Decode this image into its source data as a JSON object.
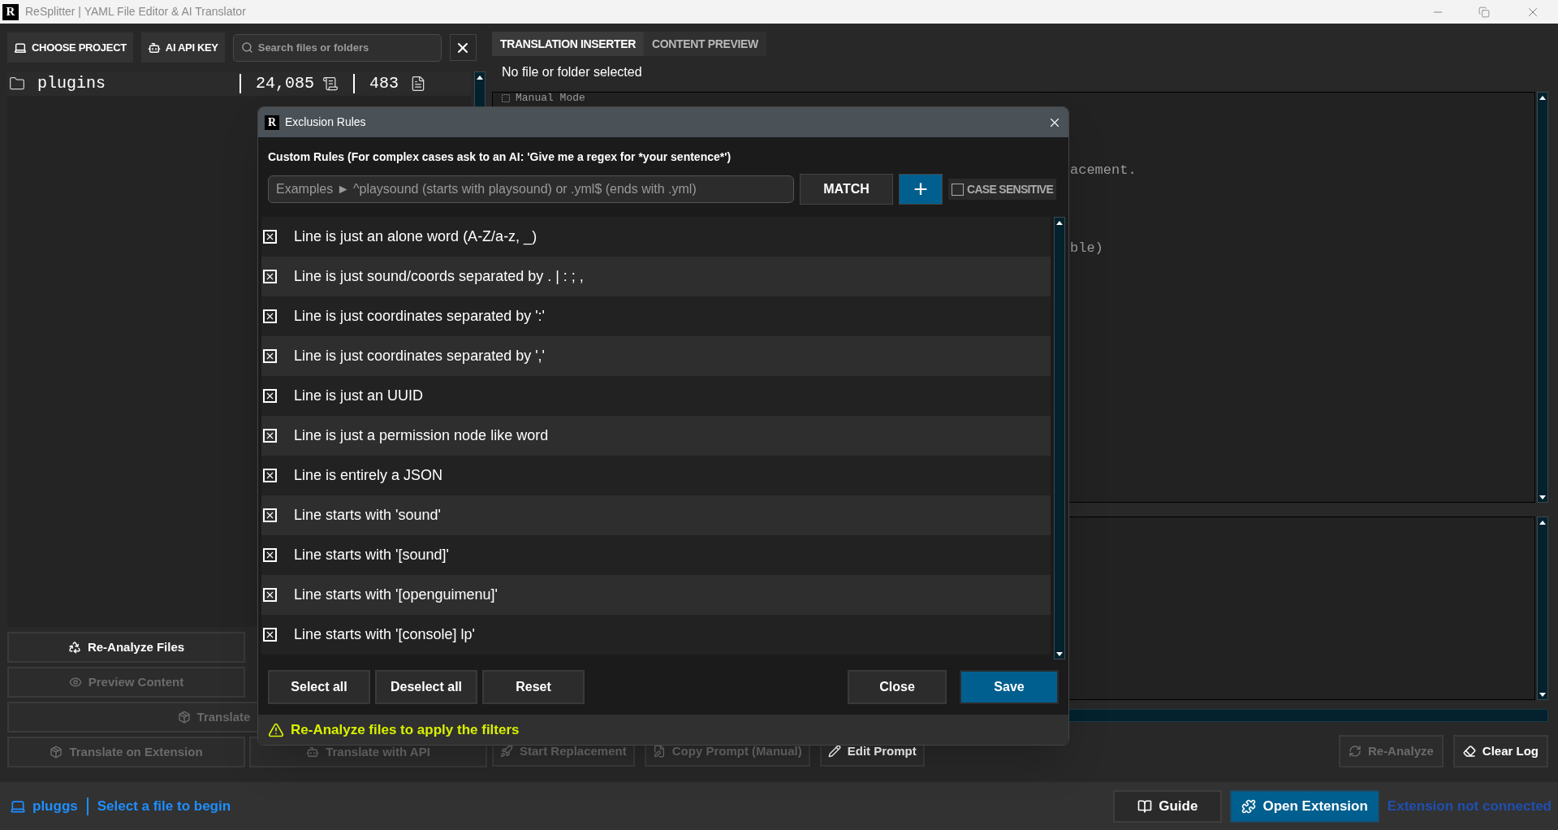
{
  "window": {
    "app_icon": "R",
    "title": "ReSplitter | YAML File Editor & AI Translator"
  },
  "toolbar": {
    "buttons": [
      {
        "label": "CHOOSE PROJECT",
        "kind": "project"
      },
      {
        "label": "AI API KEY",
        "kind": "api"
      }
    ],
    "search": {
      "placeholder": "Search files or folders"
    }
  },
  "tabs": [
    {
      "label": "TRANSLATION INSERTER",
      "selected": true
    },
    {
      "label": "CONTENT PREVIEW",
      "selected": false
    }
  ],
  "file_tree": {
    "folder": "plugins",
    "lines_count": "24,085",
    "files_count": "483"
  },
  "selection_status": "No file or folder selected",
  "editor": {
    "mode": "Manual Mode",
    "fragments": [
      "acement.",
      "ble)"
    ]
  },
  "left_actions": [
    {
      "label": "Re-Analyze Files",
      "kind": "recycle",
      "disabled": false
    },
    {
      "label": "Preview Content",
      "kind": "eye",
      "disabled": true
    },
    {
      "label": "Translate",
      "kind": "package",
      "disabled": true
    },
    {
      "label": "Translate on Extension",
      "kind": "package",
      "disabled": true
    },
    {
      "label": "Translate with API",
      "kind": "bot",
      "disabled": true
    }
  ],
  "progress": {
    "level": 0
  },
  "right_actions": [
    {
      "label": "Start Replacement",
      "kind": "rocket",
      "disabled": true
    },
    {
      "label": "Copy Prompt (Manual)",
      "kind": "filepen",
      "disabled": true
    },
    {
      "label": "Edit Prompt",
      "kind": "pencil",
      "disabled": false
    }
  ],
  "log_actions": [
    {
      "label": "Re-Analyze",
      "kind": "refresh",
      "disabled": true
    },
    {
      "label": "Clear Log",
      "kind": "eraser",
      "disabled": false
    }
  ],
  "status_bar": {
    "project": "pluggs",
    "message": "Select a file to begin",
    "buttons": [
      {
        "label": "Guide",
        "kind": "book",
        "primary": false
      },
      {
        "label": "Open Extension",
        "kind": "puzzle",
        "primary": true
      }
    ],
    "connection": "Extension not connected"
  },
  "dialog": {
    "app_icon": "R",
    "title": "Exclusion Rules",
    "custom_label": "Custom Rules (For complex cases ask to an AI: 'Give me a regex for *your sentence*')",
    "pattern_placeholder": "Examples ► ^playsound (starts with playsound) or .yml$ (ends with .yml)",
    "match_button": "MATCH",
    "add_button": "+",
    "case_sensitive": {
      "label": "CASE SENSITIVE",
      "checked": false
    },
    "rules": [
      {
        "label": "Line is just an alone word (A-Z/a-z, _)",
        "checked": true
      },
      {
        "label": "Line is just sound/coords separated by . | : ; ,",
        "checked": true
      },
      {
        "label": "Line is just coordinates separated by ':'",
        "checked": true
      },
      {
        "label": "Line is just coordinates separated by ','",
        "checked": true
      },
      {
        "label": "Line is just an UUID",
        "checked": true
      },
      {
        "label": "Line is just a permission node like word",
        "checked": true
      },
      {
        "label": "Line is entirely a JSON",
        "checked": true
      },
      {
        "label": "Line starts with 'sound'",
        "checked": true
      },
      {
        "label": "Line starts with '[sound]'",
        "checked": true
      },
      {
        "label": "Line starts with '[openguimenu]'",
        "checked": true
      },
      {
        "label": "Line starts with '[console] lp'",
        "checked": true
      }
    ],
    "footer_left": [
      "Select all",
      "Deselect all",
      "Reset"
    ],
    "footer_right": [
      {
        "label": "Close",
        "primary": false
      },
      {
        "label": "Save",
        "primary": true
      }
    ],
    "warning": "Re-Analyze files to apply the filters"
  }
}
